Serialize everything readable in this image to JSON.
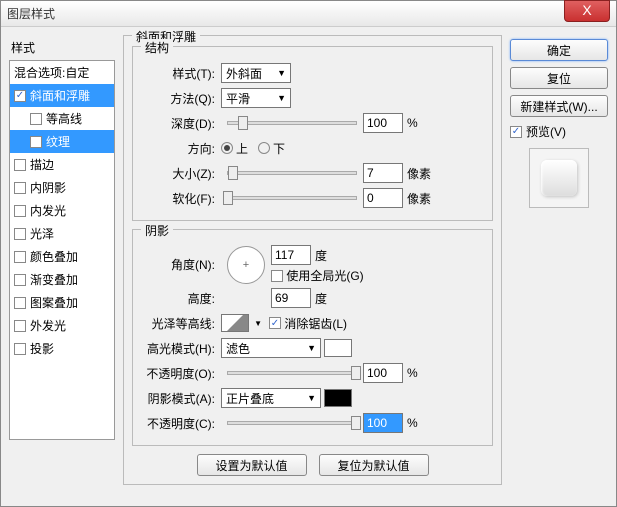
{
  "title": "图层样式",
  "close": "X",
  "styles_header": "样式",
  "style_list": [
    {
      "label": "混合选项:自定",
      "checked": false,
      "noCb": true
    },
    {
      "label": "斜面和浮雕",
      "checked": true,
      "selected": false,
      "bg": "sel-dark"
    },
    {
      "label": "等高线",
      "checked": false,
      "child": true
    },
    {
      "label": "纹理",
      "checked": false,
      "child": true,
      "selected": true
    },
    {
      "label": "描边",
      "checked": false
    },
    {
      "label": "内阴影",
      "checked": false
    },
    {
      "label": "内发光",
      "checked": false
    },
    {
      "label": "光泽",
      "checked": false
    },
    {
      "label": "颜色叠加",
      "checked": false
    },
    {
      "label": "渐变叠加",
      "checked": false
    },
    {
      "label": "图案叠加",
      "checked": false
    },
    {
      "label": "外发光",
      "checked": false
    },
    {
      "label": "投影",
      "checked": false
    }
  ],
  "group_main": "斜面和浮雕",
  "group_struct": "结构",
  "struct": {
    "style_label": "样式(T):",
    "style_val": "外斜面",
    "method_label": "方法(Q):",
    "method_val": "平滑",
    "depth_label": "深度(D):",
    "depth_val": "100",
    "depth_unit": "%",
    "dir_label": "方向:",
    "up": "上",
    "down": "下",
    "size_label": "大小(Z):",
    "size_val": "7",
    "size_unit": "像素",
    "soft_label": "软化(F):",
    "soft_val": "0",
    "soft_unit": "像素"
  },
  "group_shade": "阴影",
  "shade": {
    "angle_label": "角度(N):",
    "angle_val": "117",
    "angle_unit": "度",
    "global_label": "使用全局光(G)",
    "alt_label": "高度:",
    "alt_val": "69",
    "alt_unit": "度",
    "gloss_label": "光泽等高线:",
    "aa_label": "消除锯齿(L)",
    "hl_mode_label": "高光模式(H):",
    "hl_mode_val": "滤色",
    "hl_op_label": "不透明度(O):",
    "hl_op_val": "100",
    "hl_op_unit": "%",
    "sh_mode_label": "阴影模式(A):",
    "sh_mode_val": "正片叠底",
    "sh_op_label": "不透明度(C):",
    "sh_op_val": "100",
    "sh_op_unit": "%"
  },
  "btn_default": "设置为默认值",
  "btn_reset_default": "复位为默认值",
  "right": {
    "ok": "确定",
    "cancel": "复位",
    "new_style": "新建样式(W)...",
    "preview_label": "预览(V)"
  }
}
